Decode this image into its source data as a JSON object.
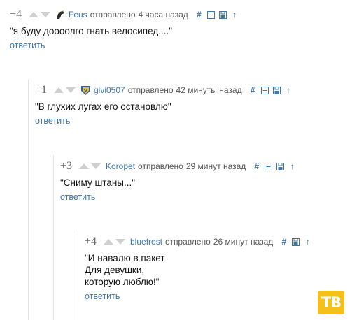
{
  "comments": [
    {
      "score": "+4",
      "author": "Feus",
      "sent_label": "отправлено",
      "time": "4 часа назад",
      "text": "\"я буду доооолго гнать велосипед....\"",
      "reply_label": "ответить",
      "avatar_icon": "pony-silhouette-icon"
    },
    {
      "score": "+1",
      "author": "givi0507",
      "sent_label": "отправлено",
      "time": "42 минуты назад",
      "text": "\"В глухих лугах его остановлю\"",
      "reply_label": "ответить",
      "avatar_icon": "shield-badge-icon"
    },
    {
      "score": "+3",
      "author": "Koropet",
      "sent_label": "отправлено",
      "time": "29 минут назад",
      "text": "\"Сниму штаны...\"",
      "reply_label": "ответить"
    },
    {
      "score": "+4",
      "author": "bluefrost",
      "sent_label": "отправлено",
      "time": "26 минут назад",
      "text": "\"И навалю в пакет\nДля девушки,\nкоторую люблю!\"",
      "reply_label": "ответить"
    }
  ],
  "actions": {
    "link_symbol": "#",
    "parent_symbol": "↑"
  },
  "watermark": {
    "text": "ТВ",
    "color": "#f3c11a"
  },
  "colors": {
    "link": "#3f75a8",
    "vote_arrow": "#cfcfcf"
  }
}
